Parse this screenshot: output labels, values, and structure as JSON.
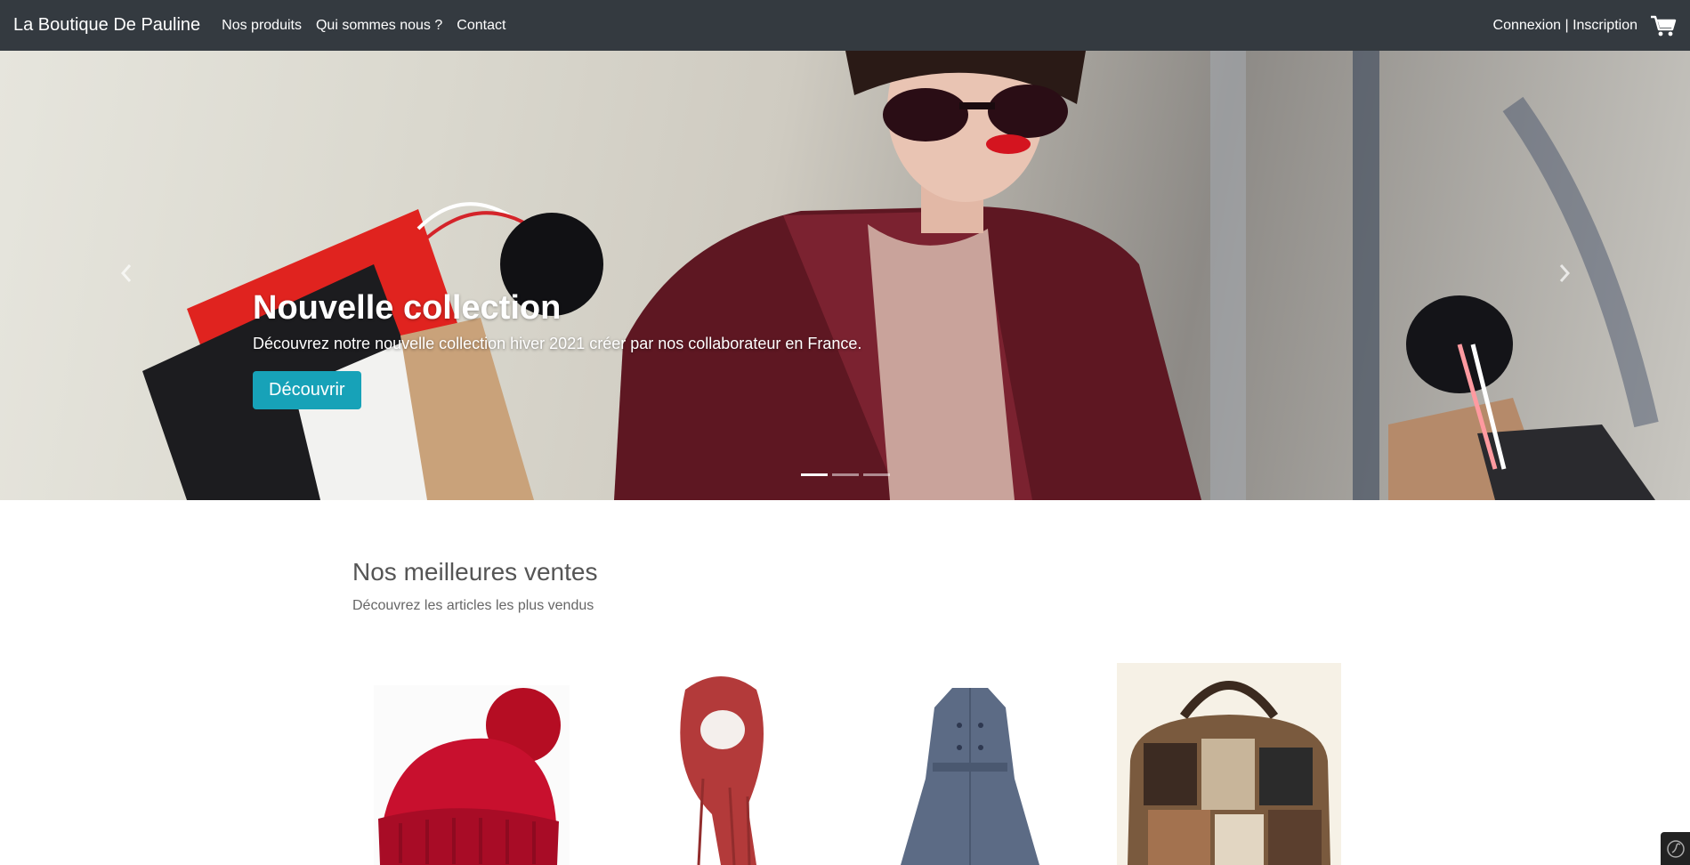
{
  "navbar": {
    "brand": "La Boutique De Pauline",
    "links": [
      "Nos produits",
      "Qui sommes nous ?",
      "Contact"
    ],
    "auth_label": "Connexion | Inscription",
    "cart_icon": "cart-icon"
  },
  "hero": {
    "title": "Nouvelle collection",
    "text": "Découvrez notre nouvelle collection hiver 2021 créer par nos collaborateur en France.",
    "button_label": "Découvrir",
    "button_color": "#17a2b8",
    "prev_icon": "chevron-left-icon",
    "next_icon": "chevron-right-icon",
    "slides": 3,
    "active_slide": 1
  },
  "bestsellers": {
    "title": "Nos meilleures ventes",
    "subtitle": "Découvrez les articles les plus vendus",
    "products": [
      {
        "icon": "red-beanie-image"
      },
      {
        "icon": "red-scarf-image"
      },
      {
        "icon": "blue-coat-image"
      },
      {
        "icon": "printed-handbag-image"
      }
    ]
  },
  "colors": {
    "navbar_bg": "#343a40",
    "accent": "#17a2b8"
  }
}
